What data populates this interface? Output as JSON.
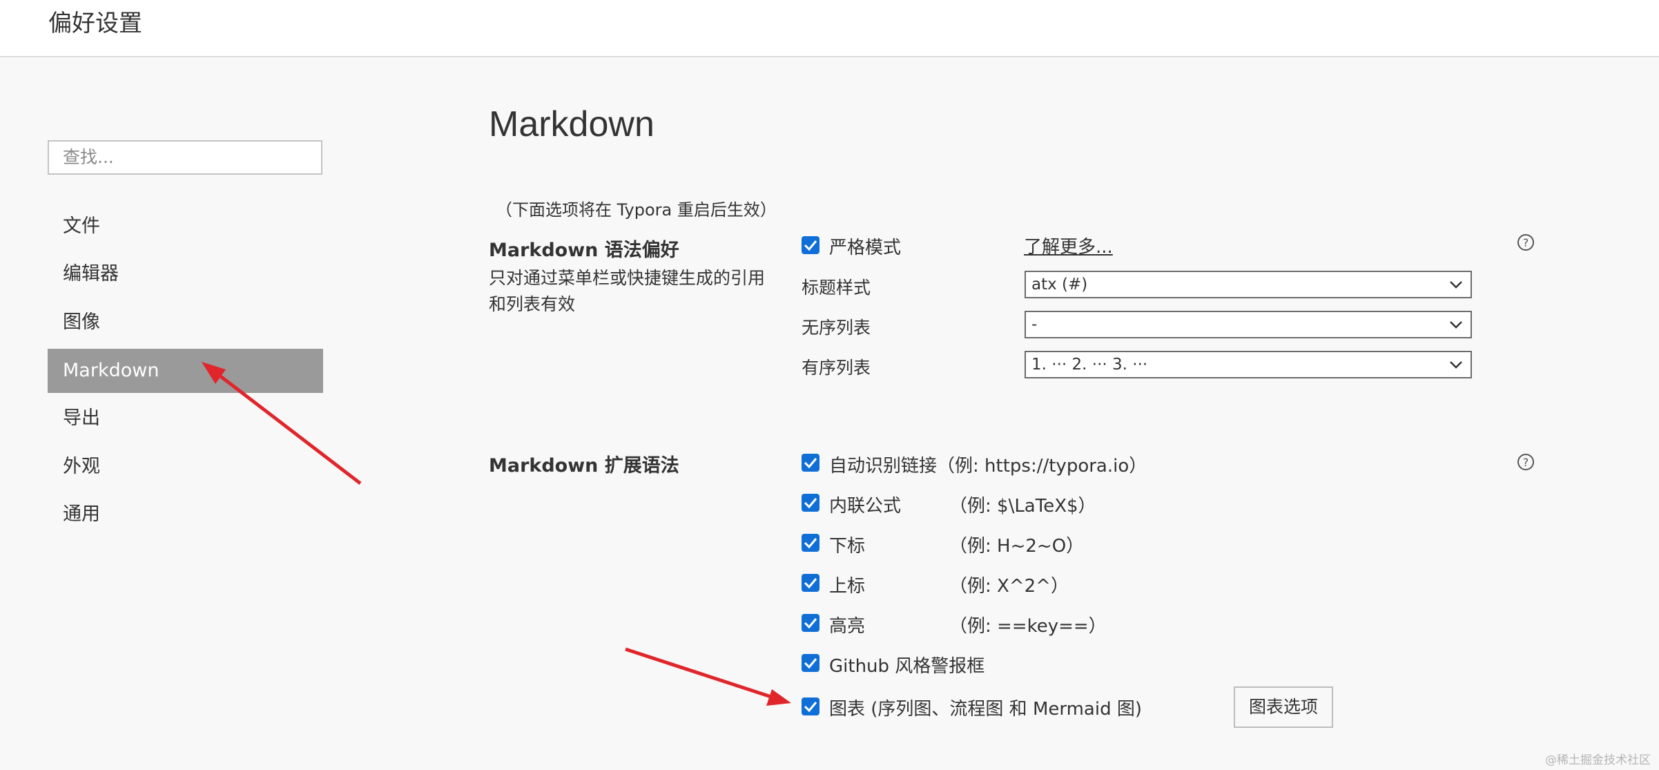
{
  "window": {
    "title": "偏好设置"
  },
  "search": {
    "placeholder": "查找..."
  },
  "sidebar": {
    "items": [
      {
        "label": "文件",
        "active": false
      },
      {
        "label": "编辑器",
        "active": false
      },
      {
        "label": "图像",
        "active": false
      },
      {
        "label": "Markdown",
        "active": true
      },
      {
        "label": "导出",
        "active": false
      },
      {
        "label": "外观",
        "active": false
      },
      {
        "label": "通用",
        "active": false
      }
    ]
  },
  "main": {
    "title": "Markdown",
    "restart_note": "（下面选项将在 Typora 重启后生效）",
    "syntax_pref": {
      "title": "Markdown 语法偏好",
      "description": "只对通过菜单栏或快捷键生成的引用和列表有效",
      "strict_mode": {
        "label": "严格模式",
        "checked": true
      },
      "learn_more": "了解更多...",
      "heading_style": {
        "label": "标题样式",
        "value": "atx (#)"
      },
      "unordered_list": {
        "label": "无序列表",
        "value": "-"
      },
      "ordered_list": {
        "label": "有序列表",
        "value": "1. ··· 2. ··· 3. ···"
      }
    },
    "extensions": {
      "title": "Markdown 扩展语法",
      "autolink": {
        "label": "自动识别链接",
        "example": "（例: https://typora.io）",
        "checked": true
      },
      "inline_math": {
        "label": "内联公式",
        "example": "（例:   $\\LaTeX$）",
        "checked": true
      },
      "subscript": {
        "label": "下标",
        "example": "（例:   H~2~O）",
        "checked": true
      },
      "superscript": {
        "label": "上标",
        "example": "（例:   X^2^）",
        "checked": true
      },
      "highlight": {
        "label": "高亮",
        "example": "（例:   ==key==）",
        "checked": true
      },
      "github_alert": {
        "label": "Github 风格警报框",
        "checked": true
      },
      "diagrams": {
        "label": "图表 (序列图、流程图 和 Mermaid 图)",
        "checked": true
      },
      "diagram_options_button": "图表选项"
    }
  },
  "colors": {
    "accent": "#0f6fd6",
    "active_nav": "#9a9a9a",
    "annotation": "#e0262b"
  },
  "icons": {
    "help": "help-circle-icon",
    "dropdown": "chevron-down-icon",
    "checkbox": "checkmark-icon"
  },
  "watermark": "@稀土掘金技术社区"
}
